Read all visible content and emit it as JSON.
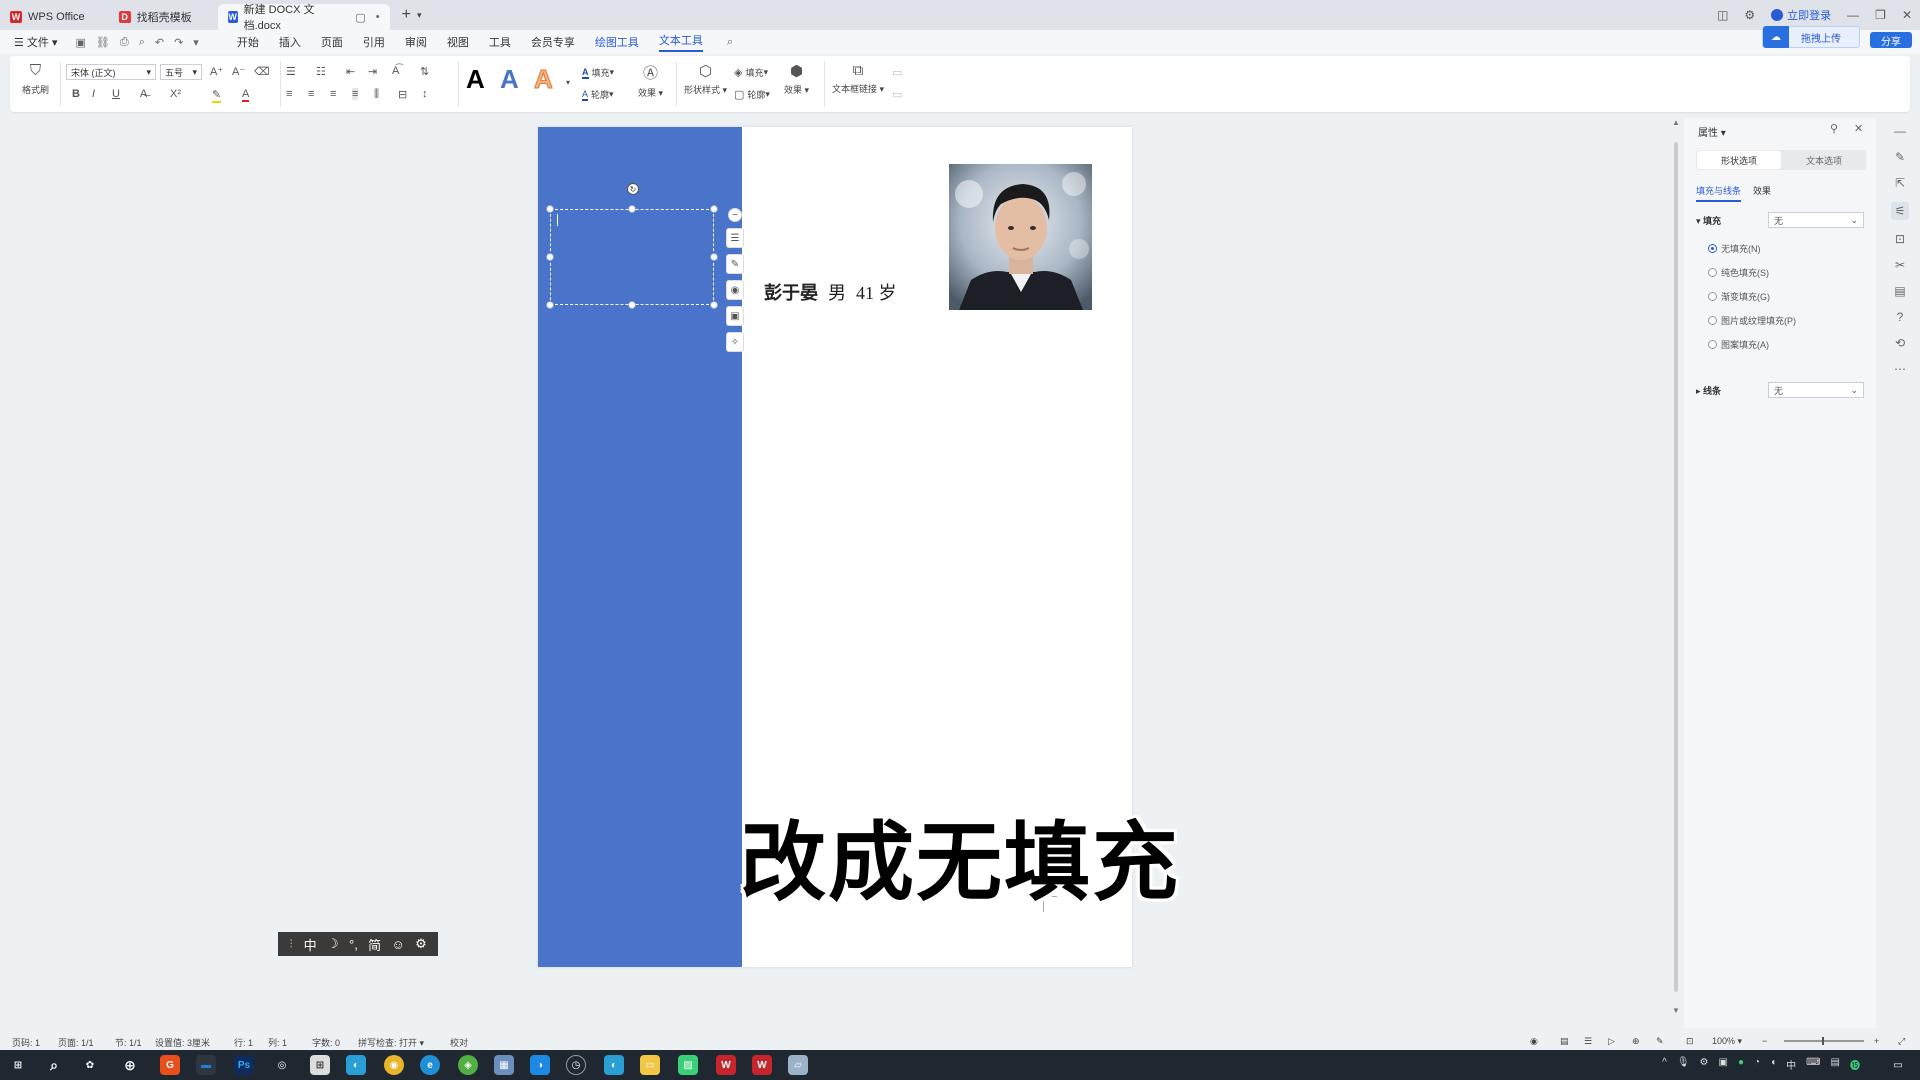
{
  "tabs": [
    {
      "label": "WPS Office",
      "icon": "wps-icon",
      "color": "#d9262c"
    },
    {
      "label": "找稻壳模板",
      "icon": "docer-icon",
      "color": "#e0393e"
    },
    {
      "label": "新建 DOCX 文档.docx",
      "icon": "word-icon",
      "color": "#2a5bd7"
    }
  ],
  "titlebar": {
    "login_label": "立即登录",
    "cloud_label": "拖拽上传",
    "share_label": "分享"
  },
  "menu": {
    "file": "文件",
    "items": [
      "开始",
      "插入",
      "页面",
      "引用",
      "审阅",
      "视图",
      "工具",
      "会员专享",
      "绘图工具",
      "文本工具"
    ],
    "active": "文本工具"
  },
  "ribbon": {
    "format_painter": "格式刷",
    "font_name": "宋体 (正文)",
    "font_size": "五号",
    "fill": "填充",
    "outline": "轮廓",
    "effect": "效果",
    "shape_style": "形状样式",
    "shape_fill": "填充",
    "shape_outline": "轮廓",
    "shape_effect": "效果",
    "textbox_link": "文本框链接"
  },
  "document": {
    "name": "彭于晏",
    "gender": "男",
    "age": "41 岁",
    "caption": "改成无填充",
    "band_color": "#4a74c9"
  },
  "panel": {
    "title": "属性",
    "seg_tabs": [
      "形状选项",
      "文本选项"
    ],
    "sub_tabs": [
      "填充与线条",
      "效果"
    ],
    "fill_label": "填充",
    "fill_value": "无",
    "fill_options": [
      "无填充(N)",
      "纯色填充(S)",
      "渐变填充(G)",
      "图片或纹理填充(P)",
      "图案填充(A)"
    ],
    "line_label": "线条",
    "line_value": "无"
  },
  "ime": {
    "items": [
      "中",
      "☽",
      "°,",
      "简",
      "☺",
      "⚙"
    ]
  },
  "status": {
    "page_num": "页码: 1",
    "pages": "页面: 1/1",
    "section": "节: 1/1",
    "setting": "设置值: 3厘米",
    "row": "行: 1",
    "col": "列: 1",
    "words": "字数: 0",
    "spell": "拼写检查: 打开",
    "proof": "校对",
    "zoom": "100%"
  }
}
